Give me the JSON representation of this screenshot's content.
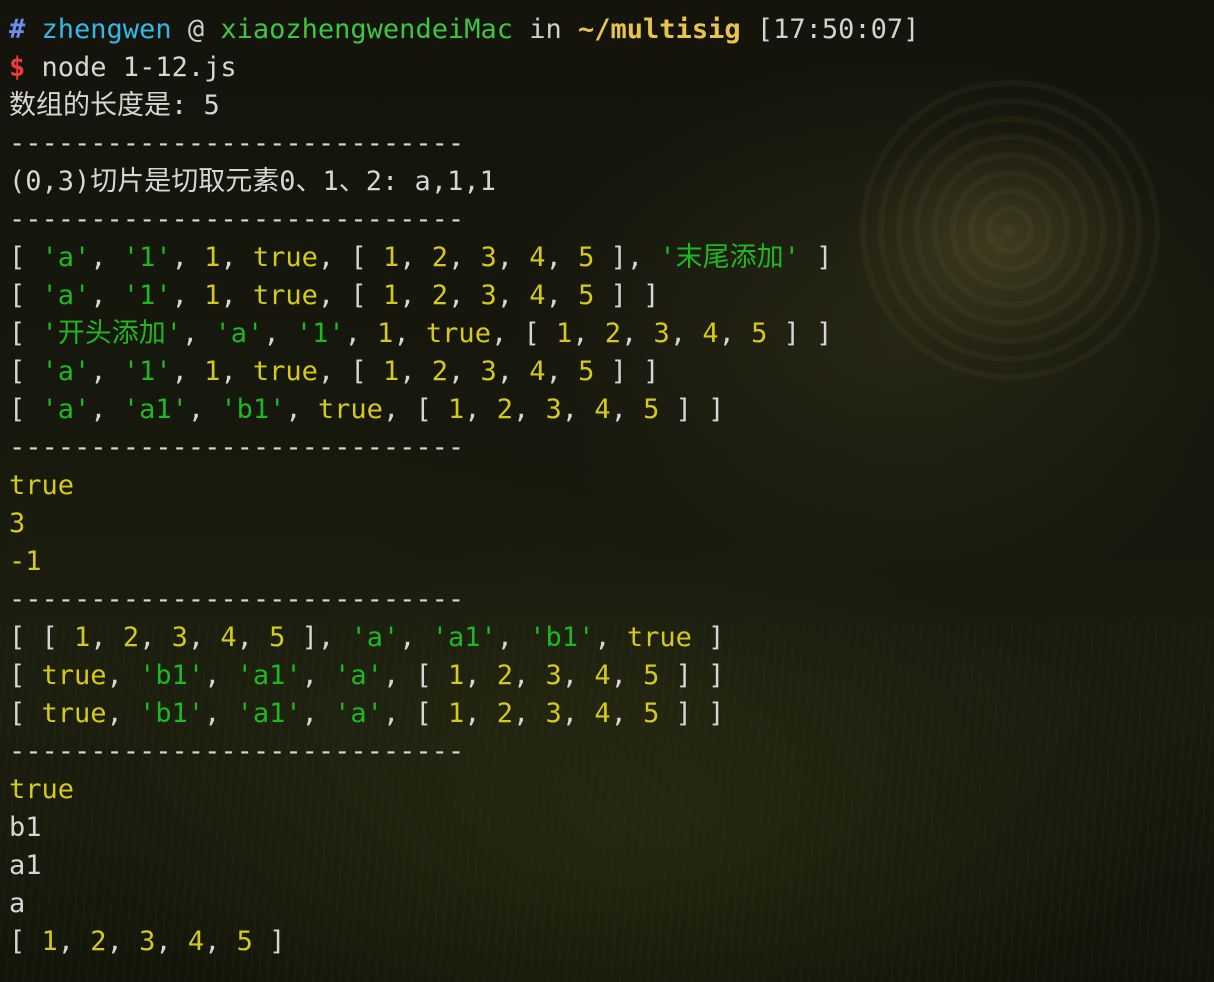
{
  "prompt": {
    "hash": "#",
    "user": "zhengwen",
    "at": "@",
    "host": "xiaozhengwendeiMac",
    "in": "in",
    "dir": "~/multisig",
    "time": "[17:50:07]",
    "dollar": "$",
    "command": "node 1-12.js"
  },
  "output": [
    [
      {
        "t": "数组的长度是: 5",
        "c": "plain"
      }
    ],
    [
      {
        "t": "----------------------------",
        "c": "plain"
      }
    ],
    [
      {
        "t": "(0,3)切片是切取元素0、1、2: a,1,1",
        "c": "plain"
      }
    ],
    [
      {
        "t": "----------------------------",
        "c": "plain"
      }
    ],
    [
      {
        "t": "[ ",
        "c": "sep"
      },
      {
        "t": "'a'",
        "c": "str"
      },
      {
        "t": ", ",
        "c": "sep"
      },
      {
        "t": "'1'",
        "c": "str"
      },
      {
        "t": ", ",
        "c": "sep"
      },
      {
        "t": "1",
        "c": "num"
      },
      {
        "t": ", ",
        "c": "sep"
      },
      {
        "t": "true",
        "c": "bool"
      },
      {
        "t": ", [ ",
        "c": "sep"
      },
      {
        "t": "1",
        "c": "num"
      },
      {
        "t": ", ",
        "c": "sep"
      },
      {
        "t": "2",
        "c": "num"
      },
      {
        "t": ", ",
        "c": "sep"
      },
      {
        "t": "3",
        "c": "num"
      },
      {
        "t": ", ",
        "c": "sep"
      },
      {
        "t": "4",
        "c": "num"
      },
      {
        "t": ", ",
        "c": "sep"
      },
      {
        "t": "5",
        "c": "num"
      },
      {
        "t": " ], ",
        "c": "sep"
      },
      {
        "t": "'末尾添加'",
        "c": "str"
      },
      {
        "t": " ]",
        "c": "sep"
      }
    ],
    [
      {
        "t": "[ ",
        "c": "sep"
      },
      {
        "t": "'a'",
        "c": "str"
      },
      {
        "t": ", ",
        "c": "sep"
      },
      {
        "t": "'1'",
        "c": "str"
      },
      {
        "t": ", ",
        "c": "sep"
      },
      {
        "t": "1",
        "c": "num"
      },
      {
        "t": ", ",
        "c": "sep"
      },
      {
        "t": "true",
        "c": "bool"
      },
      {
        "t": ", [ ",
        "c": "sep"
      },
      {
        "t": "1",
        "c": "num"
      },
      {
        "t": ", ",
        "c": "sep"
      },
      {
        "t": "2",
        "c": "num"
      },
      {
        "t": ", ",
        "c": "sep"
      },
      {
        "t": "3",
        "c": "num"
      },
      {
        "t": ", ",
        "c": "sep"
      },
      {
        "t": "4",
        "c": "num"
      },
      {
        "t": ", ",
        "c": "sep"
      },
      {
        "t": "5",
        "c": "num"
      },
      {
        "t": " ] ]",
        "c": "sep"
      }
    ],
    [
      {
        "t": "[ ",
        "c": "sep"
      },
      {
        "t": "'开头添加'",
        "c": "str"
      },
      {
        "t": ", ",
        "c": "sep"
      },
      {
        "t": "'a'",
        "c": "str"
      },
      {
        "t": ", ",
        "c": "sep"
      },
      {
        "t": "'1'",
        "c": "str"
      },
      {
        "t": ", ",
        "c": "sep"
      },
      {
        "t": "1",
        "c": "num"
      },
      {
        "t": ", ",
        "c": "sep"
      },
      {
        "t": "true",
        "c": "bool"
      },
      {
        "t": ", [ ",
        "c": "sep"
      },
      {
        "t": "1",
        "c": "num"
      },
      {
        "t": ", ",
        "c": "sep"
      },
      {
        "t": "2",
        "c": "num"
      },
      {
        "t": ", ",
        "c": "sep"
      },
      {
        "t": "3",
        "c": "num"
      },
      {
        "t": ", ",
        "c": "sep"
      },
      {
        "t": "4",
        "c": "num"
      },
      {
        "t": ", ",
        "c": "sep"
      },
      {
        "t": "5",
        "c": "num"
      },
      {
        "t": " ] ]",
        "c": "sep"
      }
    ],
    [
      {
        "t": "[ ",
        "c": "sep"
      },
      {
        "t": "'a'",
        "c": "str"
      },
      {
        "t": ", ",
        "c": "sep"
      },
      {
        "t": "'1'",
        "c": "str"
      },
      {
        "t": ", ",
        "c": "sep"
      },
      {
        "t": "1",
        "c": "num"
      },
      {
        "t": ", ",
        "c": "sep"
      },
      {
        "t": "true",
        "c": "bool"
      },
      {
        "t": ", [ ",
        "c": "sep"
      },
      {
        "t": "1",
        "c": "num"
      },
      {
        "t": ", ",
        "c": "sep"
      },
      {
        "t": "2",
        "c": "num"
      },
      {
        "t": ", ",
        "c": "sep"
      },
      {
        "t": "3",
        "c": "num"
      },
      {
        "t": ", ",
        "c": "sep"
      },
      {
        "t": "4",
        "c": "num"
      },
      {
        "t": ", ",
        "c": "sep"
      },
      {
        "t": "5",
        "c": "num"
      },
      {
        "t": " ] ]",
        "c": "sep"
      }
    ],
    [
      {
        "t": "[ ",
        "c": "sep"
      },
      {
        "t": "'a'",
        "c": "str"
      },
      {
        "t": ", ",
        "c": "sep"
      },
      {
        "t": "'a1'",
        "c": "str"
      },
      {
        "t": ", ",
        "c": "sep"
      },
      {
        "t": "'b1'",
        "c": "str"
      },
      {
        "t": ", ",
        "c": "sep"
      },
      {
        "t": "true",
        "c": "bool"
      },
      {
        "t": ", [ ",
        "c": "sep"
      },
      {
        "t": "1",
        "c": "num"
      },
      {
        "t": ", ",
        "c": "sep"
      },
      {
        "t": "2",
        "c": "num"
      },
      {
        "t": ", ",
        "c": "sep"
      },
      {
        "t": "3",
        "c": "num"
      },
      {
        "t": ", ",
        "c": "sep"
      },
      {
        "t": "4",
        "c": "num"
      },
      {
        "t": ", ",
        "c": "sep"
      },
      {
        "t": "5",
        "c": "num"
      },
      {
        "t": " ] ]",
        "c": "sep"
      }
    ],
    [
      {
        "t": "----------------------------",
        "c": "plain"
      }
    ],
    [
      {
        "t": "true",
        "c": "bool"
      }
    ],
    [
      {
        "t": "3",
        "c": "num"
      }
    ],
    [
      {
        "t": "-1",
        "c": "num"
      }
    ],
    [
      {
        "t": "----------------------------",
        "c": "plain"
      }
    ],
    [
      {
        "t": "[ [ ",
        "c": "sep"
      },
      {
        "t": "1",
        "c": "num"
      },
      {
        "t": ", ",
        "c": "sep"
      },
      {
        "t": "2",
        "c": "num"
      },
      {
        "t": ", ",
        "c": "sep"
      },
      {
        "t": "3",
        "c": "num"
      },
      {
        "t": ", ",
        "c": "sep"
      },
      {
        "t": "4",
        "c": "num"
      },
      {
        "t": ", ",
        "c": "sep"
      },
      {
        "t": "5",
        "c": "num"
      },
      {
        "t": " ], ",
        "c": "sep"
      },
      {
        "t": "'a'",
        "c": "str"
      },
      {
        "t": ", ",
        "c": "sep"
      },
      {
        "t": "'a1'",
        "c": "str"
      },
      {
        "t": ", ",
        "c": "sep"
      },
      {
        "t": "'b1'",
        "c": "str"
      },
      {
        "t": ", ",
        "c": "sep"
      },
      {
        "t": "true",
        "c": "bool"
      },
      {
        "t": " ]",
        "c": "sep"
      }
    ],
    [
      {
        "t": "[ ",
        "c": "sep"
      },
      {
        "t": "true",
        "c": "bool"
      },
      {
        "t": ", ",
        "c": "sep"
      },
      {
        "t": "'b1'",
        "c": "str"
      },
      {
        "t": ", ",
        "c": "sep"
      },
      {
        "t": "'a1'",
        "c": "str"
      },
      {
        "t": ", ",
        "c": "sep"
      },
      {
        "t": "'a'",
        "c": "str"
      },
      {
        "t": ", [ ",
        "c": "sep"
      },
      {
        "t": "1",
        "c": "num"
      },
      {
        "t": ", ",
        "c": "sep"
      },
      {
        "t": "2",
        "c": "num"
      },
      {
        "t": ", ",
        "c": "sep"
      },
      {
        "t": "3",
        "c": "num"
      },
      {
        "t": ", ",
        "c": "sep"
      },
      {
        "t": "4",
        "c": "num"
      },
      {
        "t": ", ",
        "c": "sep"
      },
      {
        "t": "5",
        "c": "num"
      },
      {
        "t": " ] ]",
        "c": "sep"
      }
    ],
    [
      {
        "t": "[ ",
        "c": "sep"
      },
      {
        "t": "true",
        "c": "bool"
      },
      {
        "t": ", ",
        "c": "sep"
      },
      {
        "t": "'b1'",
        "c": "str"
      },
      {
        "t": ", ",
        "c": "sep"
      },
      {
        "t": "'a1'",
        "c": "str"
      },
      {
        "t": ", ",
        "c": "sep"
      },
      {
        "t": "'a'",
        "c": "str"
      },
      {
        "t": ", [ ",
        "c": "sep"
      },
      {
        "t": "1",
        "c": "num"
      },
      {
        "t": ", ",
        "c": "sep"
      },
      {
        "t": "2",
        "c": "num"
      },
      {
        "t": ", ",
        "c": "sep"
      },
      {
        "t": "3",
        "c": "num"
      },
      {
        "t": ", ",
        "c": "sep"
      },
      {
        "t": "4",
        "c": "num"
      },
      {
        "t": ", ",
        "c": "sep"
      },
      {
        "t": "5",
        "c": "num"
      },
      {
        "t": " ] ]",
        "c": "sep"
      }
    ],
    [
      {
        "t": "----------------------------",
        "c": "plain"
      }
    ],
    [
      {
        "t": "true",
        "c": "bool"
      }
    ],
    [
      {
        "t": "b1",
        "c": "plain"
      }
    ],
    [
      {
        "t": "a1",
        "c": "plain"
      }
    ],
    [
      {
        "t": "a",
        "c": "plain"
      }
    ],
    [
      {
        "t": "[ ",
        "c": "sep"
      },
      {
        "t": "1",
        "c": "num"
      },
      {
        "t": ", ",
        "c": "sep"
      },
      {
        "t": "2",
        "c": "num"
      },
      {
        "t": ", ",
        "c": "sep"
      },
      {
        "t": "3",
        "c": "num"
      },
      {
        "t": ", ",
        "c": "sep"
      },
      {
        "t": "4",
        "c": "num"
      },
      {
        "t": ", ",
        "c": "sep"
      },
      {
        "t": "5",
        "c": "num"
      },
      {
        "t": " ]",
        "c": "sep"
      }
    ]
  ]
}
